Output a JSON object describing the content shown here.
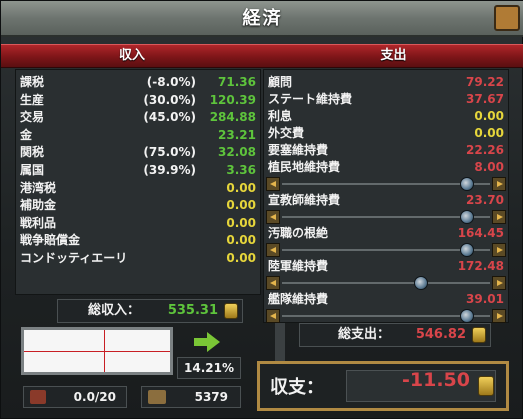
{
  "window": {
    "title": "経済"
  },
  "income": {
    "header": "収入",
    "rows": [
      {
        "label": "課税",
        "pct": "(-8.0%)",
        "value": "71.36",
        "color": "green"
      },
      {
        "label": "生産",
        "pct": "(30.0%)",
        "value": "120.39",
        "color": "green"
      },
      {
        "label": "交易",
        "pct": "(45.0%)",
        "value": "284.88",
        "color": "green"
      },
      {
        "label": "金",
        "pct": "",
        "value": "23.21",
        "color": "green"
      },
      {
        "label": "関税",
        "pct": "(75.0%)",
        "value": "32.08",
        "color": "green"
      },
      {
        "label": "属国",
        "pct": "(39.9%)",
        "value": "3.36",
        "color": "green"
      },
      {
        "label": "港湾税",
        "pct": "",
        "value": "0.00",
        "color": "yellow"
      },
      {
        "label": "補助金",
        "pct": "",
        "value": "0.00",
        "color": "yellow"
      },
      {
        "label": "戦利品",
        "pct": "",
        "value": "0.00",
        "color": "yellow"
      },
      {
        "label": "戦争賠償金",
        "pct": "",
        "value": "0.00",
        "color": "yellow"
      },
      {
        "label": "コンドッティエーリ",
        "pct": "",
        "value": "0.00",
        "color": "yellow"
      }
    ],
    "total_label": "総収入：",
    "total_value": "535.31"
  },
  "expenses": {
    "header": "支出",
    "rows": [
      {
        "label": "顧問",
        "value": "79.22",
        "color": "red",
        "slider": false
      },
      {
        "label": "ステート維持費",
        "value": "37.67",
        "color": "red",
        "slider": false
      },
      {
        "label": "利息",
        "value": "0.00",
        "color": "yellow",
        "slider": false
      },
      {
        "label": "外交費",
        "value": "0.00",
        "color": "yellow",
        "slider": false
      },
      {
        "label": "要塞維持費",
        "value": "22.26",
        "color": "red",
        "slider": false
      },
      {
        "label": "植民地維持費",
        "value": "8.00",
        "color": "red",
        "slider": true,
        "slider_level": 0.92
      },
      {
        "label": "宣教師維持費",
        "value": "23.70",
        "color": "red",
        "slider": true,
        "slider_level": 0.92
      },
      {
        "label": "汚職の根絶",
        "value": "164.45",
        "color": "red",
        "slider": true,
        "slider_level": 0.92
      },
      {
        "label": "陸軍維持費",
        "value": "172.48",
        "color": "red",
        "slider": true,
        "slider_level": 0.68
      },
      {
        "label": "艦隊維持費",
        "value": "39.01",
        "color": "red",
        "slider": true,
        "slider_level": 0.92
      }
    ],
    "total_label": "総支出：",
    "total_value": "546.82"
  },
  "inflation": {
    "value": "14.21%"
  },
  "stats": {
    "left_value": "0.0/20",
    "right_value": "5379"
  },
  "balance": {
    "label": "収支：",
    "value": "-11.50"
  },
  "colors": {
    "green": "#5ec43c",
    "yellow": "#e6d63b",
    "red": "#d8454a",
    "ribbon": "#8c1b1e",
    "gold": "#b08a43"
  },
  "icons": {
    "close": "close-icon",
    "coin": "coin-stack-icon",
    "arrow": "green-arrow-icon",
    "sword": "sword-icon",
    "map": "map-icon"
  }
}
